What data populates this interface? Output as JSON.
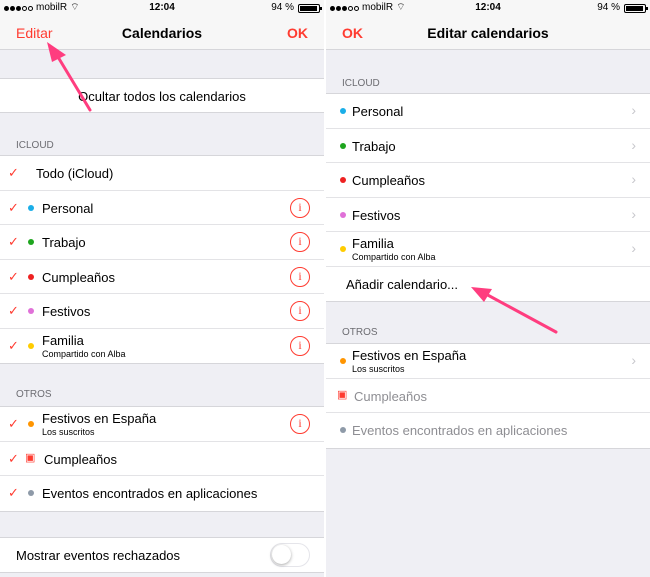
{
  "status": {
    "carrier": "mobilR",
    "time": "12:04",
    "battery": "94 %",
    "battery_level": 0.94
  },
  "colors": {
    "accent": "#ff3b30",
    "personal": "#1aaee8",
    "trabajo": "#1ea51e",
    "cumpleanos": "#ee2121",
    "festivos": "#e071d8",
    "familia": "#ffcc00",
    "festivos_espana": "#ff9500",
    "eventos": "#8e9aa8",
    "annotation": "#ff3d7f"
  },
  "left": {
    "nav": {
      "left": "Editar",
      "title": "Calendarios",
      "right": "OK"
    },
    "hide_all": "Ocultar todos los calendarios",
    "icloud_header": "ICLOUD",
    "icloud_all": "Todo (iCloud)",
    "icloud_items": [
      {
        "label": "Personal",
        "sub": "",
        "color": "#1aaee8"
      },
      {
        "label": "Trabajo",
        "sub": "",
        "color": "#1ea51e"
      },
      {
        "label": "Cumpleaños",
        "sub": "",
        "color": "#ee2121"
      },
      {
        "label": "Festivos",
        "sub": "",
        "color": "#e071d8"
      },
      {
        "label": "Familia",
        "sub": "Compartido con Alba",
        "color": "#ffcc00"
      }
    ],
    "otros_header": "OTROS",
    "otros_items": [
      {
        "label": "Festivos en España",
        "sub": "Los suscritos",
        "color": "#ff9500"
      },
      {
        "label": "Cumpleaños",
        "sub": ""
      },
      {
        "label": "Eventos encontrados en aplicaciones",
        "sub": "",
        "color": "#8e9aa8"
      }
    ],
    "declined_label": "Mostrar eventos rechazados",
    "declined_on": false
  },
  "right": {
    "nav": {
      "left": "OK",
      "title": "Editar calendarios"
    },
    "icloud_header": "ICLOUD",
    "icloud_items": [
      {
        "label": "Personal",
        "sub": "",
        "color": "#1aaee8"
      },
      {
        "label": "Trabajo",
        "sub": "",
        "color": "#1ea51e"
      },
      {
        "label": "Cumpleaños",
        "sub": "",
        "color": "#ee2121"
      },
      {
        "label": "Festivos",
        "sub": "",
        "color": "#e071d8"
      },
      {
        "label": "Familia",
        "sub": "Compartido con Alba",
        "color": "#ffcc00"
      }
    ],
    "add_calendar": "Añadir calendario...",
    "otros_header": "OTROS",
    "otros_items": [
      {
        "label": "Festivos en España",
        "sub": "Los suscritos",
        "color": "#ff9500"
      },
      {
        "label": "Cumpleaños",
        "sub": ""
      },
      {
        "label": "Eventos encontrados en aplicaciones",
        "sub": "",
        "color": "#8e9aa8"
      }
    ]
  },
  "icons": {
    "check": "✓",
    "info": "i",
    "chevron": "›",
    "gift": "🎁"
  }
}
